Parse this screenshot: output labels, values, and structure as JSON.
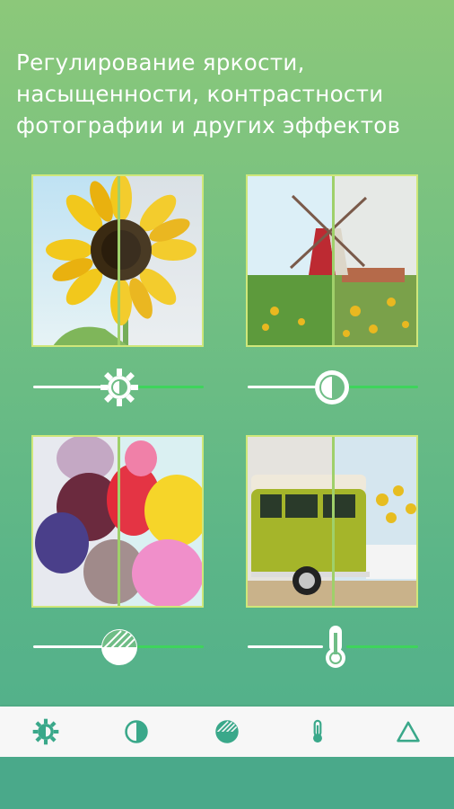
{
  "headline": "Регулирование яркости,\nнасыщенности, контрастности\nфотографии и других эффектов",
  "colors": {
    "accent": "#3ed45c",
    "frame": "#cfe77a",
    "icon": "#3aa88a",
    "bar_bg": "#f7f7f7"
  },
  "cards": [
    {
      "subject": "sunflower",
      "effect": "brightness",
      "icon": "brightness-icon"
    },
    {
      "subject": "windmill",
      "effect": "contrast",
      "icon": "contrast-icon"
    },
    {
      "subject": "balloons",
      "effect": "saturation",
      "icon": "saturation-icon"
    },
    {
      "subject": "van",
      "effect": "temperature",
      "icon": "thermometer-icon"
    }
  ],
  "sliders": {
    "brightness": 0.5,
    "contrast": 0.5,
    "saturation": 0.5,
    "temperature": 0.5
  },
  "bottom_tabs": [
    {
      "name": "brightness",
      "icon": "brightness-icon"
    },
    {
      "name": "contrast",
      "icon": "contrast-icon"
    },
    {
      "name": "saturation",
      "icon": "saturation-icon"
    },
    {
      "name": "temperature",
      "icon": "thermometer-icon"
    },
    {
      "name": "sharpness",
      "icon": "triangle-icon"
    }
  ]
}
